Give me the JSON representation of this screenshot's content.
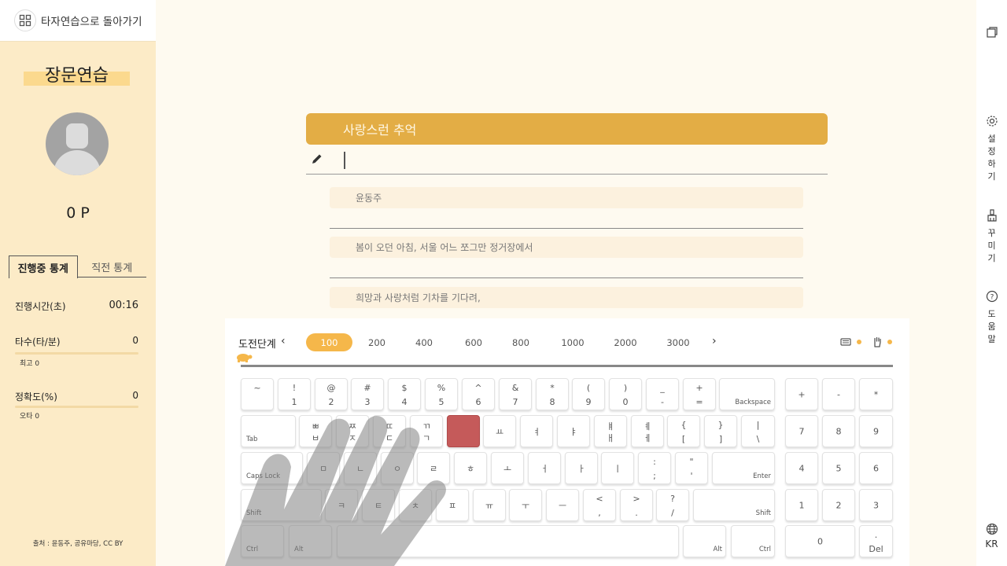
{
  "sidebar": {
    "back_label": "타자연습으로 돌아가기",
    "mode_title": "장문연습",
    "points": "0 P",
    "tabs": [
      "진행중 통계",
      "직전 통계"
    ],
    "stats": {
      "time_label": "진행시간(초)",
      "time_value": "00:16",
      "speed_label": "타수(타/분)",
      "speed_value": "0",
      "speed_sub": "최고 0",
      "accuracy_label": "정확도(%)",
      "accuracy_value": "0",
      "accuracy_sub": "오타 0"
    },
    "source": "출처 : 윤동주, 공유마당, CC BY"
  },
  "rightbar": {
    "settings": [
      "설",
      "정",
      "하",
      "기"
    ],
    "decorate": [
      "꾸",
      "미",
      "기"
    ],
    "help": [
      "도",
      "움",
      "말"
    ],
    "lang": "KR"
  },
  "practice": {
    "title": "사랑스런 추억",
    "input_value": "",
    "lines": [
      "윤동주",
      "봄이 오던 아침, 서울 어느 쪼그만 정거장에서",
      "희망과 사랑처럼 기차를 기다려,"
    ]
  },
  "levels": {
    "label": "도전단계",
    "prev": "‹",
    "next": "›",
    "items": [
      "100",
      "200",
      "400",
      "600",
      "800",
      "1000",
      "2000",
      "3000"
    ],
    "active": "100"
  },
  "keyboard": {
    "num_row": [
      {
        "t": "~",
        "b": ""
      },
      {
        "t": "!",
        "b": "1"
      },
      {
        "t": "@",
        "b": "2"
      },
      {
        "t": "#",
        "b": "3"
      },
      {
        "t": "$",
        "b": "4"
      },
      {
        "t": "%",
        "b": "5"
      },
      {
        "t": "^",
        "b": "6"
      },
      {
        "t": "&",
        "b": "7"
      },
      {
        "t": "*",
        "b": "8"
      },
      {
        "t": "(",
        "b": "9"
      },
      {
        "t": ")",
        "b": "0"
      },
      {
        "t": "_",
        "b": "-"
      },
      {
        "t": "+",
        "b": "="
      }
    ],
    "backspace": "Backspace",
    "tab": "Tab",
    "q_row": [
      {
        "t": "ㅃ",
        "b": "ㅂ"
      },
      {
        "t": "ㅉ",
        "b": "ㅈ"
      },
      {
        "t": "ㄸ",
        "b": "ㄷ"
      },
      {
        "t": "ㄲ",
        "b": "ㄱ"
      },
      {
        "t": "",
        "b": ""
      },
      {
        "t": "",
        "b": "ㅛ"
      },
      {
        "t": "",
        "b": "ㅕ"
      },
      {
        "t": "",
        "b": "ㅑ"
      },
      {
        "t": "ㅒ",
        "b": "ㅐ"
      },
      {
        "t": "ㅖ",
        "b": "ㅔ"
      },
      {
        "t": "{",
        "b": "["
      },
      {
        "t": "}",
        "b": "]"
      },
      {
        "t": "|",
        "b": "\\"
      }
    ],
    "caps": "Caps Lock",
    "a_row": [
      {
        "t": "",
        "b": "ㅁ"
      },
      {
        "t": "",
        "b": "ㄴ"
      },
      {
        "t": "",
        "b": "ㅇ"
      },
      {
        "t": "",
        "b": "ㄹ"
      },
      {
        "t": "",
        "b": "ㅎ"
      },
      {
        "t": "",
        "b": "ㅗ"
      },
      {
        "t": "",
        "b": "ㅓ"
      },
      {
        "t": "",
        "b": "ㅏ"
      },
      {
        "t": "",
        "b": "ㅣ"
      },
      {
        "t": ":",
        "b": ";"
      },
      {
        "t": "\"",
        "b": "'"
      }
    ],
    "enter": "Enter",
    "shift": "Shift",
    "z_row": [
      {
        "t": "",
        "b": "ㅋ"
      },
      {
        "t": "",
        "b": "ㅌ"
      },
      {
        "t": "",
        "b": "ㅊ"
      },
      {
        "t": "",
        "b": "ㅍ"
      },
      {
        "t": "",
        "b": "ㅠ"
      },
      {
        "t": "",
        "b": "ㅜ"
      },
      {
        "t": "",
        "b": "ㅡ"
      },
      {
        "t": "<",
        "b": ","
      },
      {
        "t": ">",
        "b": "."
      },
      {
        "t": "?",
        "b": "/"
      }
    ],
    "ctrl": "Ctrl",
    "alt": "Alt",
    "numpad": {
      "row1": [
        "+",
        "-",
        "*"
      ],
      "row2": [
        "7",
        "8",
        "9"
      ],
      "row3": [
        "4",
        "5",
        "6"
      ],
      "row4": [
        "1",
        "2",
        "3"
      ],
      "zero": "0",
      "dot": ".",
      "del": "Del"
    },
    "highlight_color": "#c55a5a"
  },
  "colors": {
    "accent": "#e3ad45",
    "sidebar_bg": "#fcebc7",
    "level_active": "#f5b74a"
  }
}
